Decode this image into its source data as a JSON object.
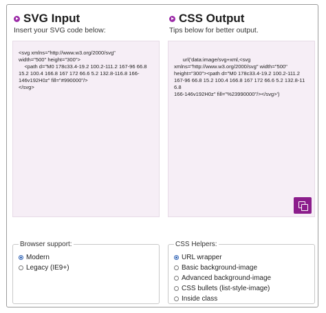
{
  "svg_panel": {
    "title": "SVG Input",
    "subtitle": "Insert your SVG code below:",
    "code": "<svg xmlns=\"http://www.w3.org/2000/svg\"\nwidth=\"500\" height=\"300\">\n    <path d=\"M0 178c33.4-19.2 100.2-111.2 167-96 66.8\n15.2 100.4 166.8 167 172 66.6 5.2 132.8-116.8 166-\n146v192H0z\" fill=\"#990000\"/>\n</svg>"
  },
  "css_panel": {
    "title": "CSS Output",
    "subtitle": "Tips below for better output.",
    "code": "url('data:image/svg+xml,<svg\nxmlns=\"http://www.w3.org/2000/svg\" width=\"500\"\nheight=\"300\"><path d=\"M0 178c33.4-19.2 100.2-111.2\n167-96 66.8 15.2 100.4 166.8 167 172 66.6 5.2 132.8-116.8\n166-146v192H0z\" fill=\"%23990000\"/></svg>')"
  },
  "browser_support": {
    "legend": "Browser support:",
    "options": [
      "Modern",
      "Legacy (IE9+)"
    ],
    "selected": "Modern"
  },
  "css_helpers": {
    "legend": "CSS Helpers:",
    "options": [
      "URL wrapper",
      "Basic background-image",
      "Advanced background-image",
      "CSS bullets (list-style-image)",
      "Inside class"
    ],
    "selected": "URL wrapper"
  },
  "colors": {
    "accent": "#8b1d8b",
    "panel_bg": "#f6eef6",
    "radio_selected": "#2b5fb3"
  },
  "icons": [
    "play-bullet-icon",
    "copy-icon"
  ]
}
